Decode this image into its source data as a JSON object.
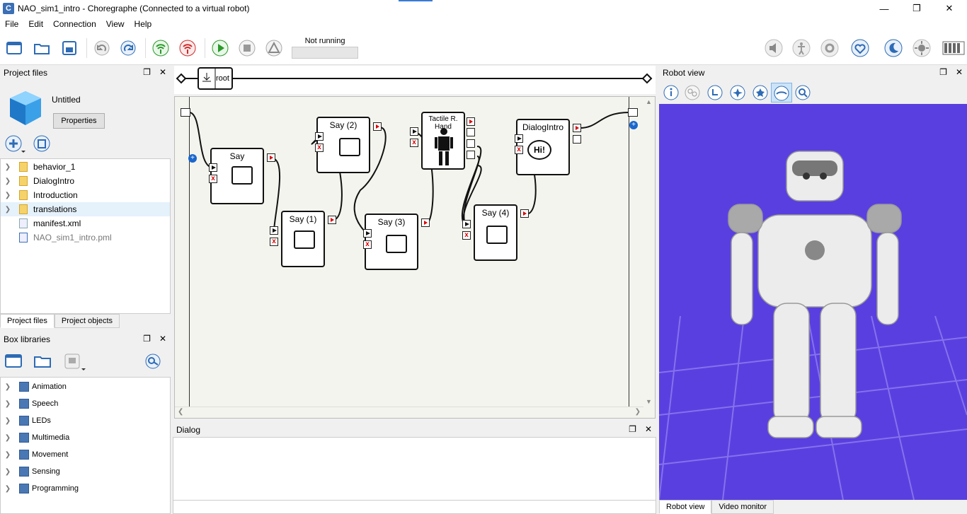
{
  "window": {
    "title": "NAO_sim1_intro - Choregraphe (Connected to a virtual robot)",
    "app_icon_letter": "C"
  },
  "menu": [
    "File",
    "Edit",
    "Connection",
    "View",
    "Help"
  ],
  "toolbar": {
    "status_label": "Not running"
  },
  "project_files": {
    "header": "Project files",
    "project_name": "Untitled",
    "properties_button": "Properties",
    "tree": [
      {
        "label": "behavior_1",
        "type": "folder"
      },
      {
        "label": "DialogIntro",
        "type": "folder"
      },
      {
        "label": "Introduction",
        "type": "folder"
      },
      {
        "label": "translations",
        "type": "folder"
      },
      {
        "label": "manifest.xml",
        "type": "file"
      },
      {
        "label": "NAO_sim1_intro.pml",
        "type": "pml"
      }
    ],
    "tabs": [
      "Project files",
      "Project objects"
    ]
  },
  "box_libraries": {
    "header": "Box libraries",
    "items": [
      "Animation",
      "Speech",
      "LEDs",
      "Multimedia",
      "Movement",
      "Sensing",
      "Programming"
    ]
  },
  "flow": {
    "root_label": "root",
    "boxes": [
      {
        "label": "Say"
      },
      {
        "label": "Say (1)"
      },
      {
        "label": "Say (2)"
      },
      {
        "label": "Say (3)"
      },
      {
        "label": "Tactile R. Hand"
      },
      {
        "label": "Say (4)"
      },
      {
        "label": "DialogIntro"
      }
    ],
    "dialog_bubble": "Hi!"
  },
  "dialog": {
    "header": "Dialog"
  },
  "robot_view": {
    "header": "Robot view",
    "tabs": [
      "Robot view",
      "Video monitor"
    ],
    "background_color": "#5a3fe0"
  }
}
